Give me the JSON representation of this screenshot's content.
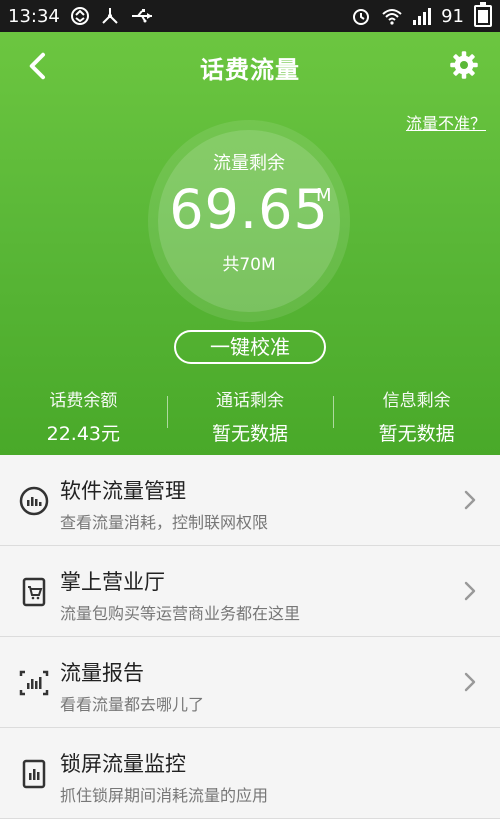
{
  "status_bar": {
    "time": "13:34",
    "battery": "91",
    "icons": [
      "sync-icon",
      "usb-icon",
      "alarm-icon",
      "wifi-icon",
      "signal-icon",
      "battery-icon"
    ]
  },
  "header": {
    "title": "话费流量",
    "back_icon": "chevron-left-icon",
    "settings_icon": "gear-icon",
    "inaccurate_link": "流量不准？"
  },
  "usage": {
    "label": "流量剩余",
    "value": "69.65",
    "unit": "M",
    "total": "共70M"
  },
  "calibrate_button": "一键校准",
  "stats": [
    {
      "label": "话费余额",
      "value": "22.43元"
    },
    {
      "label": "通话剩余",
      "value": "暂无数据"
    },
    {
      "label": "信息剩余",
      "value": "暂无数据"
    }
  ],
  "menu": [
    {
      "title": "软件流量管理",
      "subtitle": "查看流量消耗，控制联网权限",
      "icon": "gauge-icon"
    },
    {
      "title": "掌上营业厅",
      "subtitle": "流量包购买等运营商业务都在这里",
      "icon": "shopping-cart-icon"
    },
    {
      "title": "流量报告",
      "subtitle": "看看流量都去哪儿了",
      "icon": "report-chart-icon"
    },
    {
      "title": "锁屏流量监控",
      "subtitle": "抓住锁屏期间消耗流量的应用",
      "icon": "lock-monitor-icon"
    }
  ],
  "colors": {
    "header_green": "#5bb838",
    "list_bg": "#f4f4f4"
  }
}
